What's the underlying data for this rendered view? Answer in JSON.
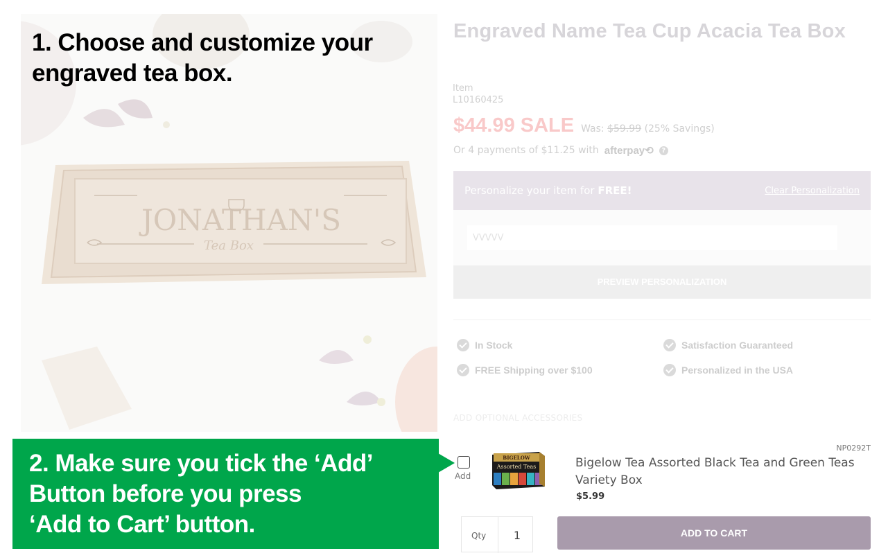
{
  "step1_text": "1. Choose and customize your\nengraved tea box.",
  "step2_text": "2. Make sure you tick the ‘Add’\nButton before you press\n‘Add to Cart’ button.",
  "hero": {
    "engraving_name": "JONATHAN'S",
    "engraving_sub": "Tea Box"
  },
  "product": {
    "title": "Engraved Name Tea Cup Acacia Tea Box",
    "item_label": "Item",
    "sku": "L10160425",
    "sale_price": "$44.99 SALE",
    "was_label": "Was:",
    "was_price": "$59.99",
    "savings": "(25% Savings)",
    "afterpay_text": "Or 4 payments of $11.25 with",
    "afterpay_logo": "afterpay",
    "help_glyph": "?"
  },
  "personalize": {
    "prefix": "Personalize your item for ",
    "free": "FREE!",
    "clear_link": "Clear Personalization",
    "input_value": "VVVVV",
    "preview_button": "PREVIEW PERSONALIZATION"
  },
  "features": {
    "in_stock": "In Stock",
    "satisfaction": "Satisfaction Guaranteed",
    "shipping": "FREE Shipping over $100",
    "usa": "Personalized in the USA"
  },
  "accessories": {
    "heading": "ADD OPTIONAL ACCESSORIES",
    "item": {
      "sku": "NP0292T",
      "add_label": "Add",
      "name": "Bigelow Tea Assorted Black Tea and Green Teas Variety Box",
      "price": "$5.99",
      "box_brand": "BIGELOW",
      "box_title": "Assorted Teas"
    },
    "qty_label": "Qty",
    "qty_value": "1",
    "add_to_cart": "ADD TO CART"
  },
  "colors": {
    "banner_green": "#00a64b",
    "cart_button": "#a99bac",
    "sale_price": "#f9c9c9",
    "personalize_bar": "#e8e3ea"
  },
  "icons": [
    "check-circle-icon",
    "help-icon",
    "checkbox-icon"
  ]
}
